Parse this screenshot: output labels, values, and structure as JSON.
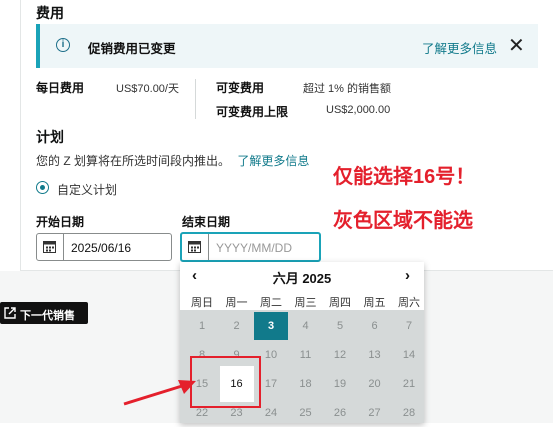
{
  "cost": {
    "title": "费用",
    "alert": {
      "message": "促销费用已变更",
      "learn_more": "了解更多信息",
      "close": "✕"
    },
    "daily_label": "每日费用",
    "daily_value": "US$70.00/天",
    "variable_label": "可变费用",
    "variable_value": "超过 1% 的销售额",
    "cap_label": "可变费用上限",
    "cap_value": "US$2,000.00"
  },
  "plan": {
    "title": "计划",
    "desc": "您的 Z 划算将在所选时间段内推出。",
    "learn_more": "了解更多信息",
    "option": "自定义计划",
    "start_label": "开始日期",
    "start_value": "2025/06/16",
    "end_label": "结束日期",
    "end_placeholder": "YYYY/MM/DD"
  },
  "annotations": {
    "line1": "仅能选择16号！",
    "line2": "灰色区域不能选"
  },
  "calendar": {
    "month": "六月 2025",
    "prev": "‹",
    "next": "›",
    "weekdays": [
      "周日",
      "周一",
      "周二",
      "周三",
      "周四",
      "周五",
      "周六"
    ],
    "selected_day": 3,
    "available_day": 16,
    "rows": [
      [
        "1",
        "2",
        "3",
        "4",
        "5",
        "6",
        "7"
      ],
      [
        "8",
        "9",
        "10",
        "11",
        "12",
        "13",
        "14"
      ],
      [
        "15",
        "16",
        "17",
        "18",
        "19",
        "20",
        "21"
      ],
      [
        "22",
        "23",
        "24",
        "25",
        "26",
        "27",
        "28"
      ]
    ]
  },
  "next_gen_button": "下一代销售",
  "colors": {
    "accent": "#117a8b",
    "alert_bar": "#1aa3b8",
    "annotation_red": "#e4202c"
  }
}
